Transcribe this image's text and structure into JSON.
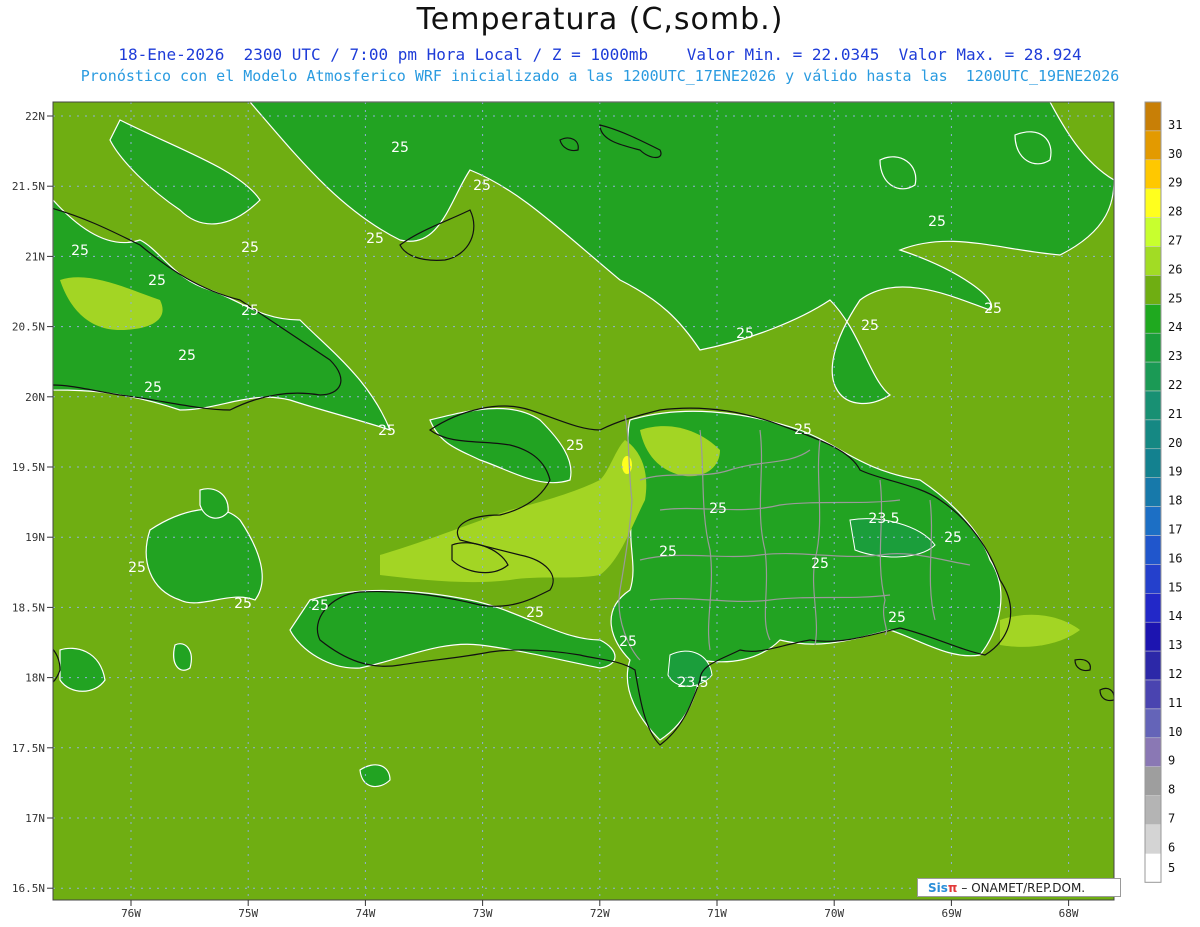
{
  "header": {
    "title": "Temperatura (C,somb.)",
    "line1": "18-Ene-2026  2300 UTC / 7:00 pm Hora Local / Z = 1000mb    Valor Min. = 22.0345  Valor Max. = 28.924",
    "line2": "Pronóstico con el Modelo Atmosferico WRF inicializado a las 1200UTC_17ENE2026 y válido hasta las  1200UTC_19ENE2026"
  },
  "map": {
    "lat_labels": [
      "22N",
      "21.5N",
      "21N",
      "20.5N",
      "20N",
      "19.5N",
      "19N",
      "18.5N",
      "18N",
      "17.5N",
      "17N",
      "16.5N"
    ],
    "lon_labels": [
      "76W",
      "75W",
      "74W",
      "73W",
      "72W",
      "71W",
      "70W",
      "69W",
      "68W"
    ],
    "contour_labels": [
      "25",
      "25",
      "25",
      "25",
      "25",
      "25",
      "25",
      "25",
      "25",
      "25",
      "25",
      "25",
      "25",
      "25",
      "25",
      "25",
      "25",
      "25",
      "25",
      "25",
      "25",
      "25",
      "25",
      "25",
      "25",
      "23.5",
      "23.5",
      "25"
    ],
    "background_color": "#6fae12"
  },
  "colorbar": {
    "labels": [
      "31",
      "30",
      "29",
      "28",
      "27",
      "26",
      "25",
      "24",
      "23",
      "22",
      "21",
      "20",
      "19",
      "18",
      "17",
      "16",
      "15",
      "14",
      "13",
      "12",
      "11",
      "10",
      "9",
      "8",
      "7",
      "6",
      "5"
    ],
    "colors": [
      "#c87f06",
      "#e39a00",
      "#ffc800",
      "#ffff1e",
      "#c8ff2e",
      "#a2dc24",
      "#6fae12",
      "#1fa91f",
      "#1b9e3b",
      "#1b9a55",
      "#189073",
      "#158883",
      "#13818f",
      "#1779aa",
      "#1c6fc5",
      "#2056cc",
      "#2440cc",
      "#2228c8",
      "#1c14b0",
      "#2c28a8",
      "#4a44b0",
      "#6464b8",
      "#8a78b4",
      "#9e9e9e",
      "#b4b4b4",
      "#d4d4d4",
      "#ffffff"
    ]
  },
  "credit": {
    "brand_sis": "Sis",
    "brand_pi": "π",
    "text": "– ONAMET/REP.DOM."
  }
}
